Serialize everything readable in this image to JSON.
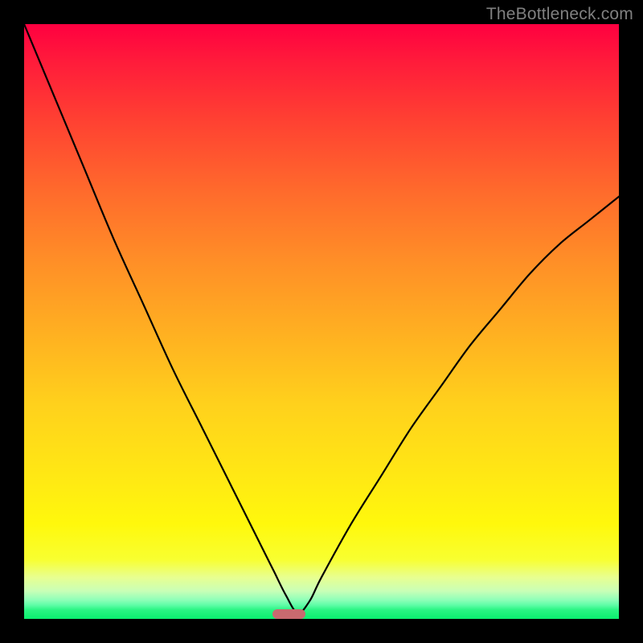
{
  "watermark": "TheBottleneck.com",
  "chart_data": {
    "type": "line",
    "title": "",
    "xlabel": "",
    "ylabel": "",
    "xlim": [
      0,
      100
    ],
    "ylim": [
      0,
      100
    ],
    "gradient_stops": [
      {
        "pos": 0,
        "color": "#ff0040"
      },
      {
        "pos": 16,
        "color": "#ff4032"
      },
      {
        "pos": 40,
        "color": "#ff8f27"
      },
      {
        "pos": 64,
        "color": "#ffd11c"
      },
      {
        "pos": 84,
        "color": "#fff80c"
      },
      {
        "pos": 93,
        "color": "#e8ff90"
      },
      {
        "pos": 97,
        "color": "#5dfda6"
      },
      {
        "pos": 100,
        "color": "#0aef6e"
      }
    ],
    "series": [
      {
        "name": "bottleneck-curve",
        "x": [
          0,
          5,
          10,
          15,
          20,
          25,
          30,
          35,
          40,
          42,
          44,
          46,
          48,
          50,
          55,
          60,
          65,
          70,
          75,
          80,
          85,
          90,
          95,
          100
        ],
        "y": [
          100,
          88,
          76,
          64,
          53,
          42,
          32,
          22,
          12,
          8,
          4,
          1,
          3,
          7,
          16,
          24,
          32,
          39,
          46,
          52,
          58,
          63,
          67,
          71
        ]
      }
    ],
    "annotations": [
      {
        "name": "optimal-marker",
        "x": 44.5,
        "width": 5.5,
        "y": 0.8,
        "color": "#c96a6f"
      }
    ]
  }
}
